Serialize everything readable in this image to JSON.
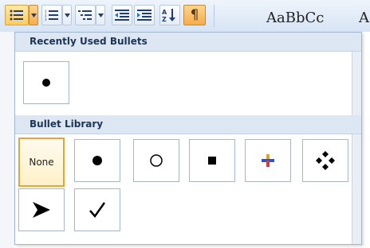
{
  "toolbar": {
    "styles_preview": "AaBbCc",
    "styles_preview_cut": "A",
    "sort_label": "A Z",
    "pilcrow": "¶"
  },
  "recently_used": {
    "header": "Recently Used Bullets",
    "items": [
      "●"
    ]
  },
  "library": {
    "header": "Bullet Library",
    "items": [
      "None",
      "●",
      "○",
      "■",
      "✚",
      "❖",
      "➤",
      "✓"
    ]
  },
  "colors": {
    "accent_hot": "#ffcc5c",
    "header_bg": "#dde7f3",
    "ribbon_bg": "#d7e4f4"
  }
}
